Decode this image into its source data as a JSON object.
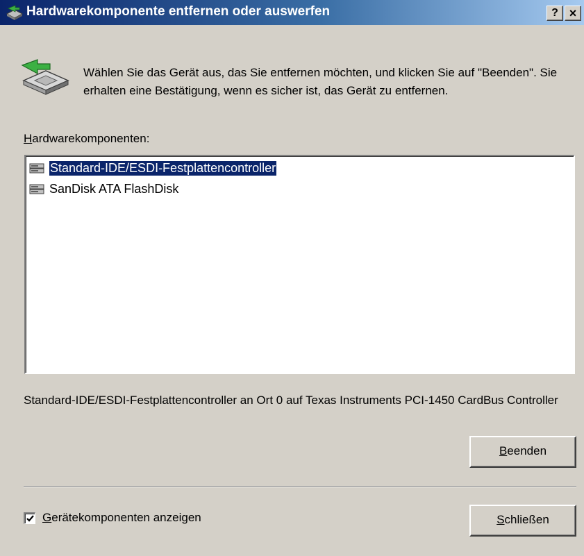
{
  "window": {
    "title": "Hardwarekomponente entfernen oder auswerfen",
    "help_label": "?",
    "close_label": "×"
  },
  "instructions": "Wählen Sie das Gerät aus, das Sie entfernen möchten, und klicken Sie auf \"Beenden\". Sie erhalten eine Bestätigung, wenn es sicher ist, das Gerät zu entfernen.",
  "hardware_label": {
    "accel": "H",
    "rest": "ardwarekomponenten:"
  },
  "devices": [
    {
      "label": "Standard-IDE/ESDI-Festplattencontroller",
      "selected": true,
      "icon": "drive-icon"
    },
    {
      "label": "SanDisk ATA FlashDisk",
      "selected": false,
      "icon": "drive-icon"
    }
  ],
  "location_text": "Standard-IDE/ESDI-Festplattencontroller an Ort 0 auf Texas Instruments PCI-1450 CardBus Controller",
  "stop_button": {
    "accel": "B",
    "rest": "eenden"
  },
  "show_components": {
    "accel": "G",
    "rest": "erätekomponenten anzeigen",
    "checked": true
  },
  "close_button": {
    "accel": "S",
    "rest": "chließen"
  },
  "colors": {
    "title_start": "#0a246a",
    "title_end": "#a6caf0",
    "face": "#d4d0c8",
    "selection": "#0a246a"
  }
}
